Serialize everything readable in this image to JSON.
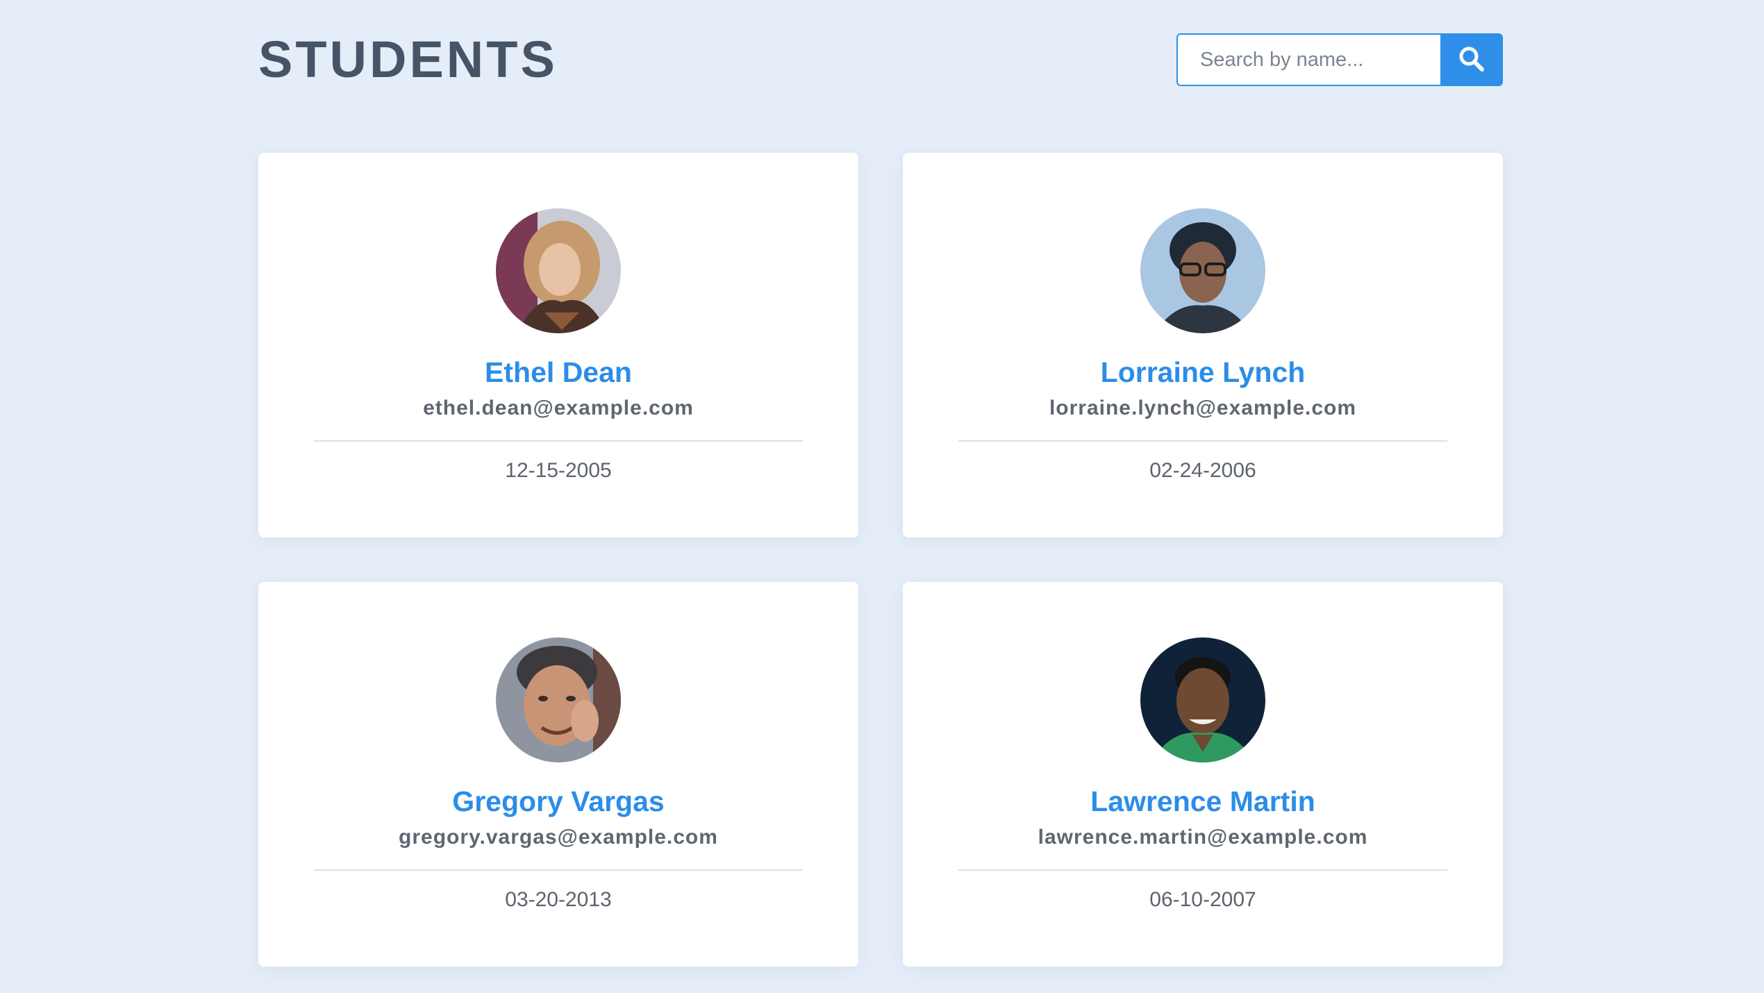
{
  "header": {
    "title": "STUDENTS",
    "search_placeholder": "Search by name...",
    "search_icon": "search-icon"
  },
  "colors": {
    "background": "#e4edf8",
    "accent": "#2f8fe8",
    "title": "#475467"
  },
  "students": [
    {
      "name": "Ethel Dean",
      "email": "ethel.dean@example.com",
      "date": "12-15-2005"
    },
    {
      "name": "Lorraine Lynch",
      "email": "lorraine.lynch@example.com",
      "date": "02-24-2006"
    },
    {
      "name": "Gregory Vargas",
      "email": "gregory.vargas@example.com",
      "date": "03-20-2013"
    },
    {
      "name": "Lawrence Martin",
      "email": "lawrence.martin@example.com",
      "date": "06-10-2007"
    }
  ]
}
